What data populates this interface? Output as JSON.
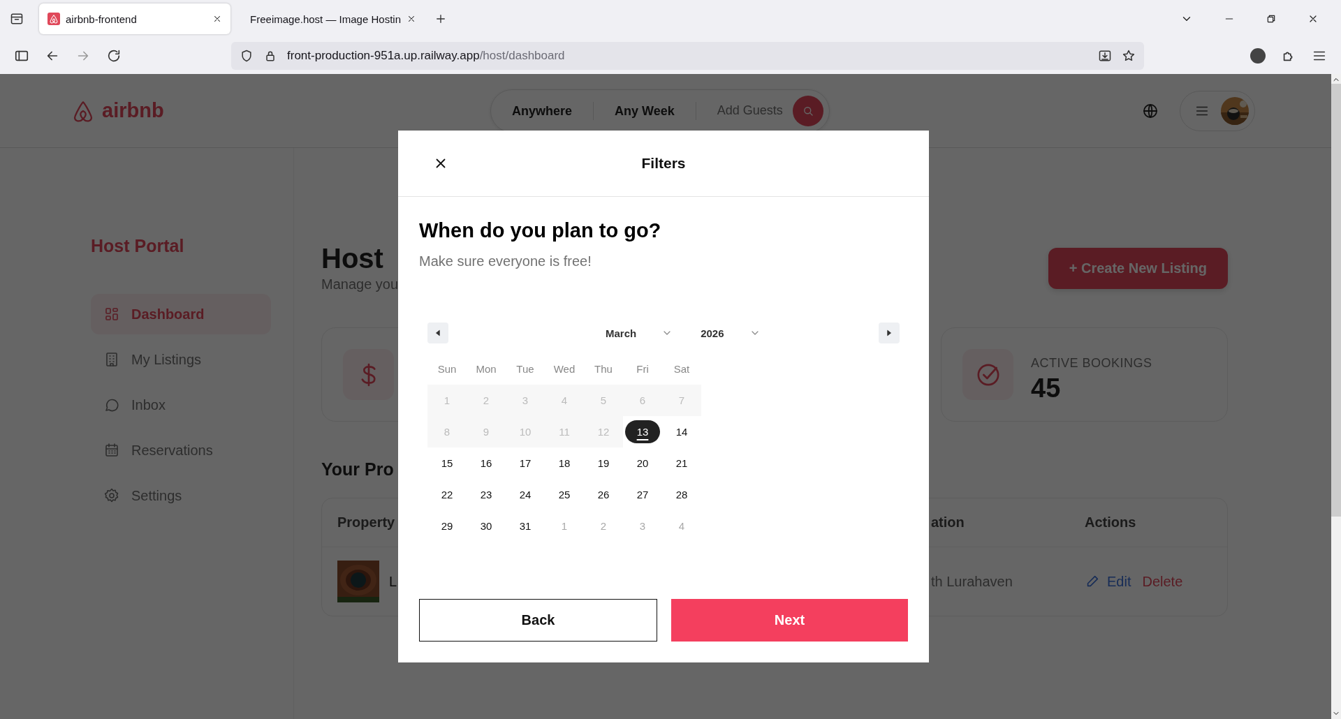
{
  "browser": {
    "tabs": [
      {
        "title": "airbnb-frontend",
        "selected": true
      },
      {
        "title": "Freeimage.host — Image Hostin",
        "selected": false
      }
    ],
    "address": {
      "host": "front-production-951a.up.railway.app",
      "path": "/host/dashboard"
    }
  },
  "header": {
    "logo": "airbnb",
    "search": [
      "Anywhere",
      "Any Week"
    ],
    "search_placeholder": "Add Guests"
  },
  "sidebar": {
    "title": "Host Portal",
    "items": [
      {
        "label": "Dashboard",
        "selected": true
      },
      {
        "label": "My Listings",
        "selected": false
      },
      {
        "label": "Inbox",
        "selected": false
      },
      {
        "label": "Reservations",
        "selected": false
      },
      {
        "label": "Settings",
        "selected": false
      }
    ]
  },
  "main": {
    "title": "Host",
    "subtitle": "Manage you",
    "create_button": "+ Create New Listing",
    "stats": [
      {
        "kind": "revenue"
      },
      {
        "kind": "bookings",
        "label": "ACTIVE BOOKINGS",
        "value": "45"
      }
    ],
    "section_title": "Your Pro",
    "table": {
      "columns": [
        "Property",
        "ation",
        "Actions"
      ],
      "rows": [
        {
          "title": "L",
          "location": "th Lurahaven",
          "actions": [
            "Edit",
            "Delete"
          ]
        }
      ]
    }
  },
  "modal": {
    "title": "Filters",
    "heading": "When do you plan to go?",
    "subheading": "Make sure everyone is free!",
    "month": "March",
    "year": "2026",
    "weekdays": [
      "Sun",
      "Mon",
      "Tue",
      "Wed",
      "Thu",
      "Fri",
      "Sat"
    ],
    "weeks": [
      [
        {
          "day": "1",
          "kind": "past",
          "selected": false
        },
        {
          "day": "2",
          "kind": "past",
          "selected": false
        },
        {
          "day": "3",
          "kind": "past",
          "selected": false
        },
        {
          "day": "4",
          "kind": "past",
          "selected": false
        },
        {
          "day": "5",
          "kind": "past",
          "selected": false
        },
        {
          "day": "6",
          "kind": "past",
          "selected": false
        },
        {
          "day": "7",
          "kind": "past",
          "selected": false
        }
      ],
      [
        {
          "day": "8",
          "kind": "past",
          "selected": false
        },
        {
          "day": "9",
          "kind": "past",
          "selected": false
        },
        {
          "day": "10",
          "kind": "past",
          "selected": false
        },
        {
          "day": "11",
          "kind": "past",
          "selected": false
        },
        {
          "day": "12",
          "kind": "past",
          "selected": false
        },
        {
          "day": "13",
          "kind": "today",
          "selected": true
        },
        {
          "day": "14",
          "kind": "current",
          "selected": false
        }
      ],
      [
        {
          "day": "15",
          "kind": "current",
          "selected": false
        },
        {
          "day": "16",
          "kind": "current",
          "selected": false
        },
        {
          "day": "17",
          "kind": "current",
          "selected": false
        },
        {
          "day": "18",
          "kind": "current",
          "selected": false
        },
        {
          "day": "19",
          "kind": "current",
          "selected": false
        },
        {
          "day": "20",
          "kind": "current",
          "selected": false
        },
        {
          "day": "21",
          "kind": "current",
          "selected": false
        }
      ],
      [
        {
          "day": "22",
          "kind": "current",
          "selected": false
        },
        {
          "day": "23",
          "kind": "current",
          "selected": false
        },
        {
          "day": "24",
          "kind": "current",
          "selected": false
        },
        {
          "day": "25",
          "kind": "current",
          "selected": false
        },
        {
          "day": "26",
          "kind": "current",
          "selected": false
        },
        {
          "day": "27",
          "kind": "current",
          "selected": false
        },
        {
          "day": "28",
          "kind": "current",
          "selected": false
        }
      ],
      [
        {
          "day": "29",
          "kind": "current",
          "selected": false
        },
        {
          "day": "30",
          "kind": "current",
          "selected": false
        },
        {
          "day": "31",
          "kind": "current",
          "selected": false
        },
        {
          "day": "1",
          "kind": "outside",
          "selected": false
        },
        {
          "day": "2",
          "kind": "outside",
          "selected": false
        },
        {
          "day": "3",
          "kind": "outside",
          "selected": false
        },
        {
          "day": "4",
          "kind": "outside",
          "selected": false
        }
      ]
    ],
    "buttons": [
      {
        "label": "Back",
        "kind": "secondary"
      },
      {
        "label": "Next",
        "kind": "primary"
      }
    ]
  }
}
